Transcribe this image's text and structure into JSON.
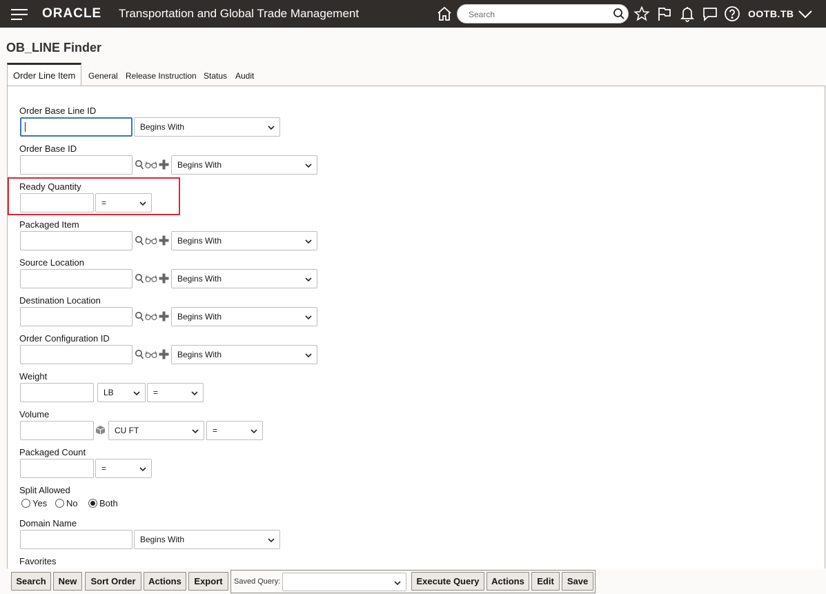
{
  "header": {
    "brand": "ORACLE",
    "app_title": "Transportation and Global Trade Management",
    "search_placeholder": "Search",
    "user": "OOTB.TB"
  },
  "page": {
    "title": "OB_LINE Finder"
  },
  "tabs": [
    {
      "label": "Order Line Item",
      "active": true
    },
    {
      "label": "General"
    },
    {
      "label": "Release Instruction"
    },
    {
      "label": "Status"
    },
    {
      "label": "Audit"
    }
  ],
  "fields": {
    "order_base_line_id": {
      "label": "Order Base Line ID",
      "operator": "Begins With"
    },
    "order_base_id": {
      "label": "Order Base ID",
      "operator": "Begins With"
    },
    "ready_quantity": {
      "label": "Ready Quantity",
      "operator": "="
    },
    "packaged_item": {
      "label": "Packaged Item",
      "operator": "Begins With"
    },
    "source_location": {
      "label": "Source Location",
      "operator": "Begins With"
    },
    "destination_location": {
      "label": "Destination Location",
      "operator": "Begins With"
    },
    "order_configuration_id": {
      "label": "Order Configuration ID",
      "operator": "Begins With"
    },
    "weight": {
      "label": "Weight",
      "unit": "LB",
      "operator": "="
    },
    "volume": {
      "label": "Volume",
      "unit": "CU FT",
      "operator": "="
    },
    "packaged_count": {
      "label": "Packaged Count",
      "operator": "="
    },
    "split_allowed": {
      "label": "Split Allowed",
      "options": [
        "Yes",
        "No",
        "Both"
      ],
      "selected": "Both"
    },
    "domain_name": {
      "label": "Domain Name",
      "operator": "Begins With"
    },
    "favorites": {
      "label": "Favorites"
    }
  },
  "toolbar": {
    "search": "Search",
    "new": "New",
    "sort_order": "Sort Order",
    "actions": "Actions",
    "export": "Export",
    "saved_query_label": "Saved Query:",
    "saved_query_value": "",
    "execute_query": "Execute Query",
    "actions2": "Actions",
    "edit": "Edit",
    "save": "Save"
  },
  "colors": {
    "header_bg": "#312d2a",
    "highlight": "#e0252f",
    "focus": "#3a73c0"
  }
}
